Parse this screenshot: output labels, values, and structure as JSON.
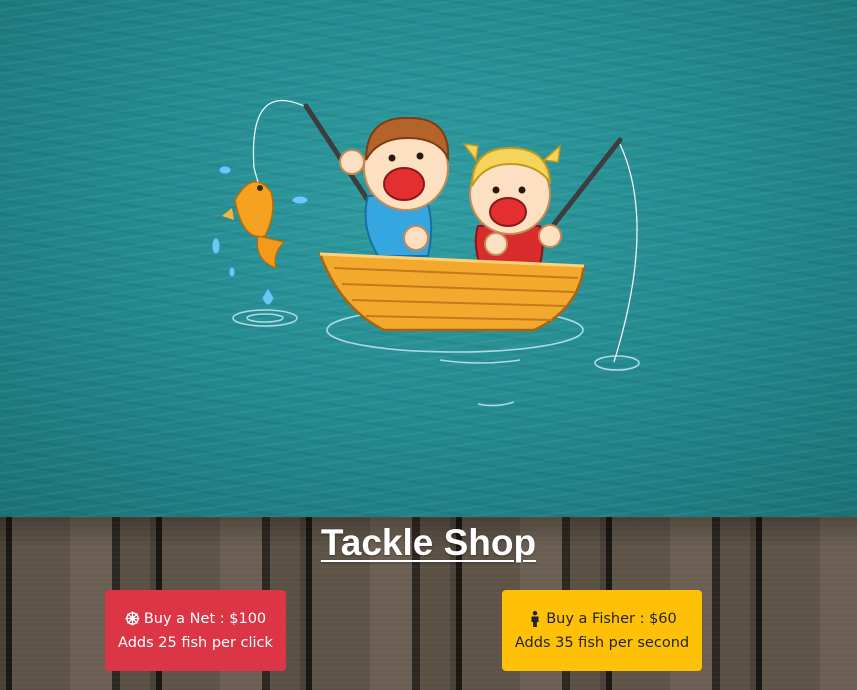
{
  "shop": {
    "title": "Tackle Shop",
    "net": {
      "label": "Buy a Net : $100",
      "desc": "Adds 25 fish per click",
      "icon": "dharma-wheel-icon",
      "color": "#dc3545"
    },
    "fisher": {
      "label": "Buy a Fisher : $60",
      "desc": "Adds 35 fish per second",
      "icon": "person-icon",
      "color": "#ffc107"
    }
  }
}
